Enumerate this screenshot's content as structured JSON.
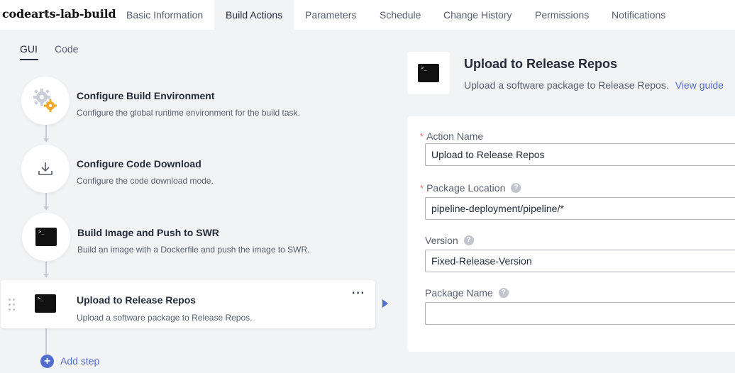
{
  "header": {
    "project_name": "codearts-lab-build",
    "tabs": [
      {
        "label": "Basic Information",
        "active": false
      },
      {
        "label": "Build Actions",
        "active": true
      },
      {
        "label": "Parameters",
        "active": false
      },
      {
        "label": "Schedule",
        "active": false
      },
      {
        "label": "Change History",
        "active": false
      },
      {
        "label": "Permissions",
        "active": false
      },
      {
        "label": "Notifications",
        "active": false
      }
    ]
  },
  "editor_tabs": [
    {
      "label": "GUI",
      "active": true
    },
    {
      "label": "Code",
      "active": false
    }
  ],
  "steps": [
    {
      "title": "Configure Build Environment",
      "desc": "Configure the global runtime environment for the build task.",
      "icon": "gears-icon"
    },
    {
      "title": "Configure Code Download",
      "desc": "Configure the code download mode.",
      "icon": "download-icon"
    },
    {
      "title": "Build Image and Push to SWR",
      "desc": "Build an image with a Dockerfile and push the image to SWR.",
      "icon": "terminal-icon"
    },
    {
      "title": "Upload to Release Repos",
      "desc": "Upload a software package to Release Repos.",
      "icon": "terminal-icon",
      "selected": true
    }
  ],
  "add_step_label": "Add step",
  "detail": {
    "title": "Upload to Release Repos",
    "desc": "Upload a software package to Release Repos.",
    "view_guide": "View guide",
    "icon": "terminal-icon"
  },
  "form": {
    "action_name": {
      "label": "Action Name",
      "required": true,
      "value": "Upload to Release Repos"
    },
    "package_location": {
      "label": "Package Location",
      "required": true,
      "value": "pipeline-deployment/pipeline/*"
    },
    "version": {
      "label": "Version",
      "required": false,
      "value": "Fixed-Release-Version"
    },
    "package_name": {
      "label": "Package Name",
      "required": false,
      "value": ""
    }
  },
  "terminal_glyph": ">_",
  "help_glyph": "?",
  "more_glyph": "···",
  "add_glyph": "+",
  "colors": {
    "accent": "#526ecc",
    "required": "#f66f6a",
    "panel_bg": "#f2f3f5"
  }
}
